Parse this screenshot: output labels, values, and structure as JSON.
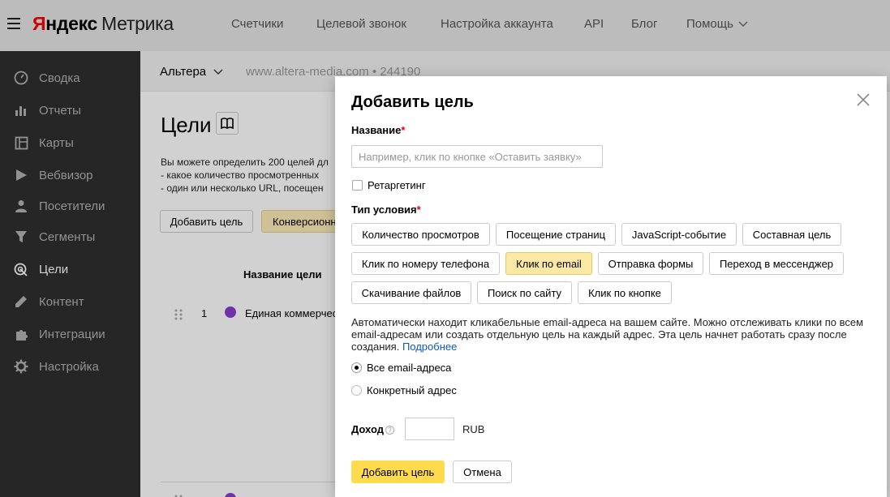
{
  "topbar": {
    "logo_ya": "Я",
    "logo_ndex": "ндекс",
    "logo_product": "Метрика",
    "nav": [
      "Счетчики",
      "Целевой звонок",
      "Настройка аккаунта",
      "API",
      "Блог",
      "Помощь"
    ]
  },
  "sidebar": {
    "items": [
      {
        "label": "Сводка",
        "icon": "gauge-icon"
      },
      {
        "label": "Отчеты",
        "icon": "bar-chart-icon"
      },
      {
        "label": "Карты",
        "icon": "map-icon"
      },
      {
        "label": "Вебвизор",
        "icon": "play-icon"
      },
      {
        "label": "Посетители",
        "icon": "person-icon"
      },
      {
        "label": "Сегменты",
        "icon": "funnel-icon"
      },
      {
        "label": "Цели",
        "icon": "target-icon",
        "active": true
      },
      {
        "label": "Контент",
        "icon": "pencil-icon"
      },
      {
        "label": "Интеграции",
        "icon": "puzzle-icon"
      },
      {
        "label": "Настройка",
        "icon": "gear-icon"
      }
    ]
  },
  "main": {
    "counter_name": "Альтера",
    "counter_url": "www.altera-media.com • 244190",
    "title": "Цели",
    "desc_line1": "Вы можете определить 200 целей дл",
    "desc_line2": "- какое количество просмотренных",
    "desc_line3": "- один или несколько URL, посещен",
    "add_goal_button": "Добавить цель",
    "conversion_button": "Конверсионн",
    "table_header_name": "Название цели",
    "rows": [
      {
        "num": "1",
        "name": "Единая коммерчес"
      }
    ]
  },
  "modal": {
    "title": "Добавить цель",
    "name_label": "Название",
    "required_mark": "*",
    "name_placeholder": "Например, клик по кнопке «Оставить заявку»",
    "name_value": "",
    "retargeting_label": "Ретаргетинг",
    "retargeting_checked": false,
    "condition_label": "Тип условия",
    "conditions": [
      "Количество просмотров",
      "Посещение страниц",
      "JavaScript-событие",
      "Составная цель",
      "Клик по номеру телефона",
      "Клик по email",
      "Отправка формы",
      "Переход в мессенджер",
      "Скачивание файлов",
      "Поиск по сайту",
      "Клик по кнопке"
    ],
    "active_condition": "Клик по email",
    "description": "Автоматически находит кликабельные email-адреса на вашем сайте. Можно отслеживать клики по всем email-адресам или создать отдельную цель на каждый адрес. Эта цель начнет работать сразу после создания.",
    "more_link": "Подробнее",
    "radio_all": "Все email-адреса",
    "radio_specific": "Конкретный адрес",
    "selected_radio": "all",
    "income_label": "Доход",
    "income_help": "?",
    "income_value": "",
    "currency": "RUB",
    "submit_button": "Добавить цель",
    "cancel_button": "Отмена"
  },
  "colors": {
    "accent": "#ffdb4d",
    "sidebar_bg": "#2f2f2f",
    "link": "#0f55c9",
    "required": "#e0001a"
  }
}
